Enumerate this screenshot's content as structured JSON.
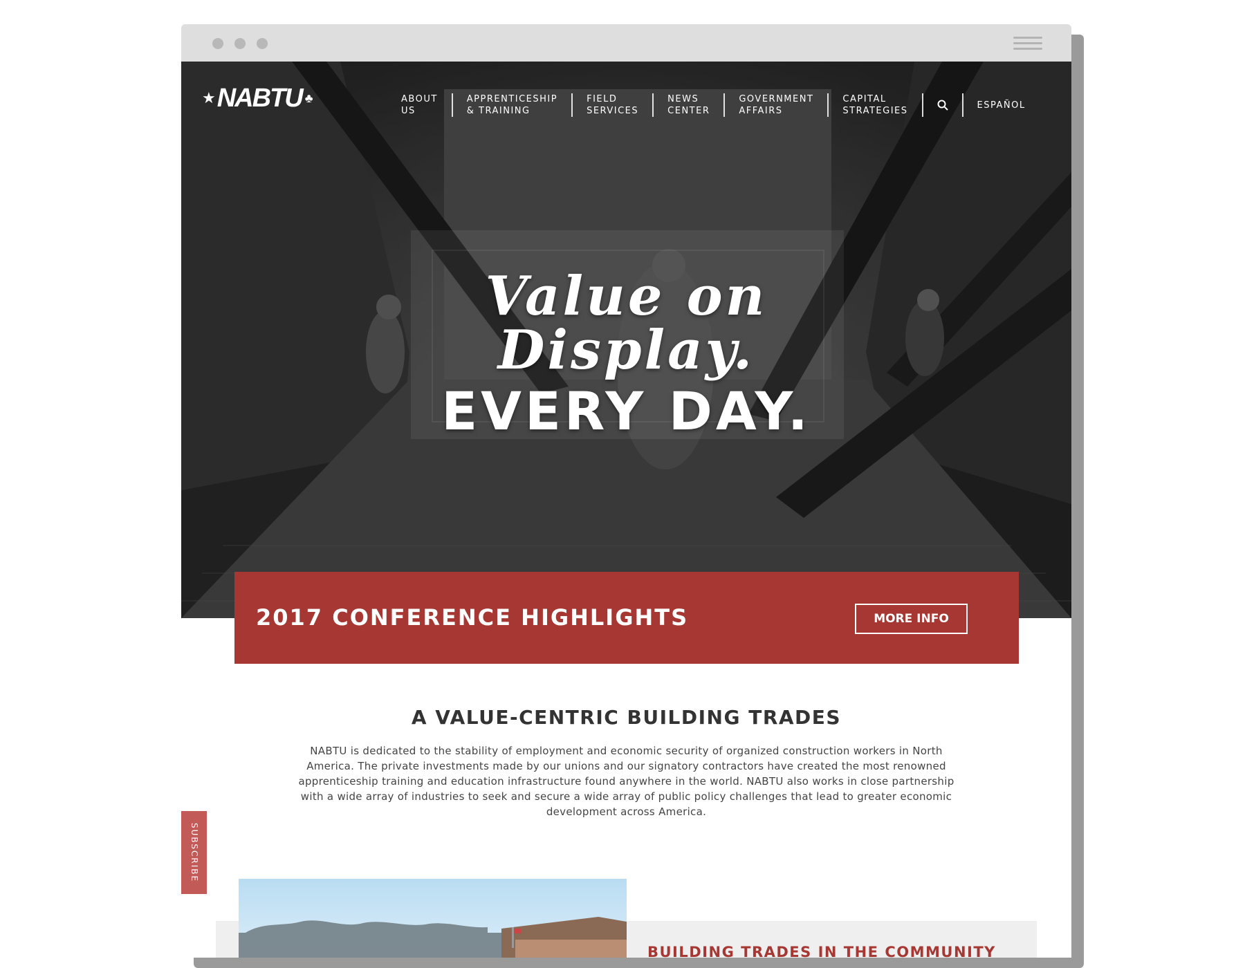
{
  "nav": {
    "logo_text": "NABTU",
    "items": [
      {
        "label": "ABOUT\nUS"
      },
      {
        "label": "APPRENTICESHIP\n& TRAINING"
      },
      {
        "label": "FIELD\nSERVICES"
      },
      {
        "label": "NEWS\nCENTER"
      },
      {
        "label": "GOVERNMENT\nAFFAIRS"
      },
      {
        "label": "CAPITAL\nSTRATEGIES"
      }
    ],
    "search_icon": "search-icon",
    "language": "ESPAÑOL"
  },
  "hero": {
    "line1": "Value on",
    "line2": "Display.",
    "line3": "EVERY DAY."
  },
  "banner": {
    "title": "2017 CONFERENCE HIGHLIGHTS",
    "button": "MORE INFO"
  },
  "intro": {
    "title": "A VALUE-CENTRIC BUILDING TRADES",
    "body": "NABTU is dedicated to the stability of employment and economic security of organized construction workers in North America. The private investments made by our unions and our signatory contractors have created the most renowned apprenticeship training and education infrastructure found anywhere in the world. NABTU also works in close partnership with a wide array of industries to seek and secure a wide array of public policy challenges that lead to greater economic development across America."
  },
  "subscribe": "SUBSCRIBE",
  "community": {
    "title": "BUILDING TRADES IN THE COMMUNITY"
  },
  "colors": {
    "accent": "#a63732",
    "subscribe_tab": "#c25a57",
    "chrome": "#dedede"
  }
}
